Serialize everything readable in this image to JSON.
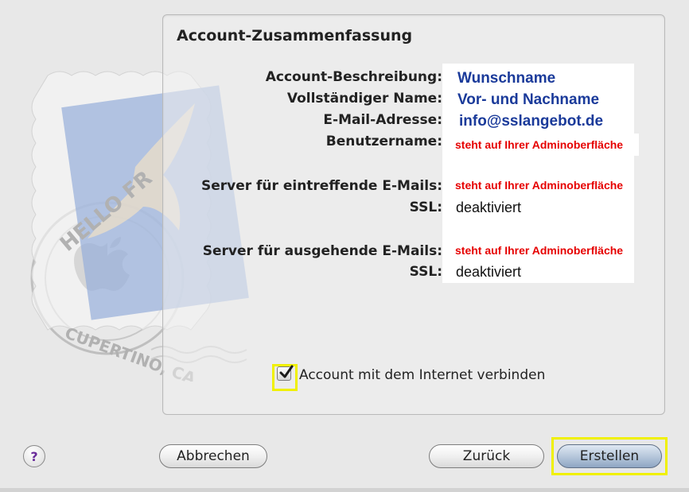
{
  "panel": {
    "title": "Account-Zusammenfassung"
  },
  "stamp": {
    "text_hello": "HELLO FR",
    "text_city": "CUPERTINO, CA"
  },
  "summary": [
    {
      "label": "Account-Beschreibung:",
      "value": "Wunschname"
    },
    {
      "label": "Vollständiger Name:",
      "value": "Vor- und Nachname"
    },
    {
      "label": "E-Mail-Adresse:",
      "value": "info@sslangebot.de"
    },
    {
      "label": "Benutzername:",
      "value": "steht auf Ihrer Adminoberfläche"
    },
    {
      "label": "Server für eintreffende E-Mails:",
      "value": "steht auf Ihrer Adminoberfläche"
    },
    {
      "label": "SSL:",
      "value": "deaktiviert"
    },
    {
      "label": "Server für ausgehende E-Mails:",
      "value": "steht auf Ihrer Adminoberfläche"
    },
    {
      "label": "SSL:",
      "value": "deaktiviert"
    }
  ],
  "connect": {
    "label": "Account mit dem Internet verbinden",
    "checked": true
  },
  "buttons": {
    "help": "?",
    "cancel": "Abbrechen",
    "back": "Zurück",
    "create": "Erstellen"
  },
  "colors": {
    "highlight": "#f0f000",
    "value_blue": "#1a3a9a",
    "value_red": "#e60000"
  }
}
